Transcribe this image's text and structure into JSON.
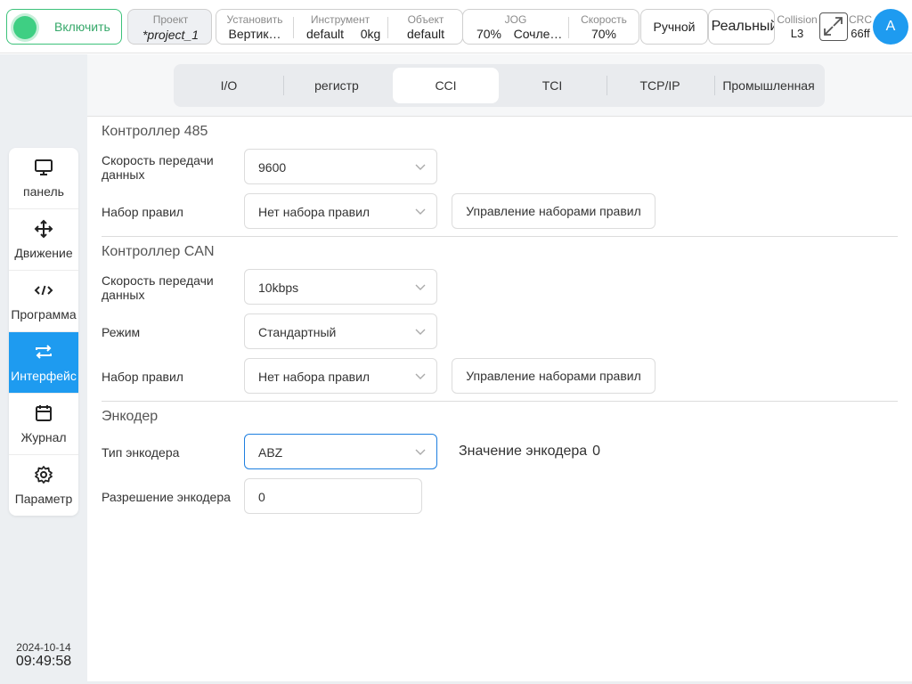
{
  "topbar": {
    "power_label": "Включить",
    "project": {
      "title": "Проект",
      "value": "*project_1"
    },
    "install": {
      "title": "Установить",
      "value": "Вертик…"
    },
    "tool": {
      "title": "Инструмент",
      "value": "default",
      "payload": "0kg"
    },
    "object": {
      "title": "Объект",
      "value": "default"
    },
    "jog": {
      "title": "JOG",
      "value": "70%",
      "mode": "Сочле…"
    },
    "speed": {
      "title": "Скорость",
      "value": "70%"
    },
    "mode_button": "Ручной",
    "real_button": "Реальный",
    "collision": {
      "title": "Collision",
      "value": "L3"
    },
    "crc": {
      "title": "CRC",
      "value": "66ff"
    },
    "avatar": "A"
  },
  "sidebar": {
    "items": [
      {
        "label": "панель",
        "icon": "monitor-icon"
      },
      {
        "label": "Движение",
        "icon": "move-icon"
      },
      {
        "label": "Программа",
        "icon": "code-icon"
      },
      {
        "label": "Интерфейс",
        "icon": "swap-icon",
        "active": true
      },
      {
        "label": "Журнал",
        "icon": "calendar-icon"
      },
      {
        "label": "Параметр",
        "icon": "gear-icon"
      }
    ],
    "date": "2024-10-14",
    "time": "09:49:58"
  },
  "tabs": [
    "I/O",
    "регистр",
    "CCI",
    "TCI",
    "TCP/IP",
    "Промышленная"
  ],
  "active_tab": "CCI",
  "controller485": {
    "title": "Контроллер 485",
    "baud_label": "Скорость передачи данных",
    "baud_value": "9600",
    "ruleset_label": "Набор правил",
    "ruleset_value": "Нет набора правил",
    "manage_button": "Управление наборами правил"
  },
  "controllerCAN": {
    "title": "Контроллер CAN",
    "baud_label": "Скорость передачи данных",
    "baud_value": "10kbps",
    "mode_label": "Режим",
    "mode_value": "Стандартный",
    "ruleset_label": "Набор правил",
    "ruleset_value": "Нет набора правил",
    "manage_button": "Управление наборами правил"
  },
  "encoder": {
    "title": "Энкодер",
    "type_label": "Тип энкодера",
    "type_value": "ABZ",
    "value_label": "Значение энкодера",
    "value": "0",
    "resolution_label": "Разрешение энкодера",
    "resolution_value": "0"
  },
  "colors": {
    "accent": "#1e9bf0",
    "power_green": "#3ecf83",
    "background": "#eceff2"
  }
}
